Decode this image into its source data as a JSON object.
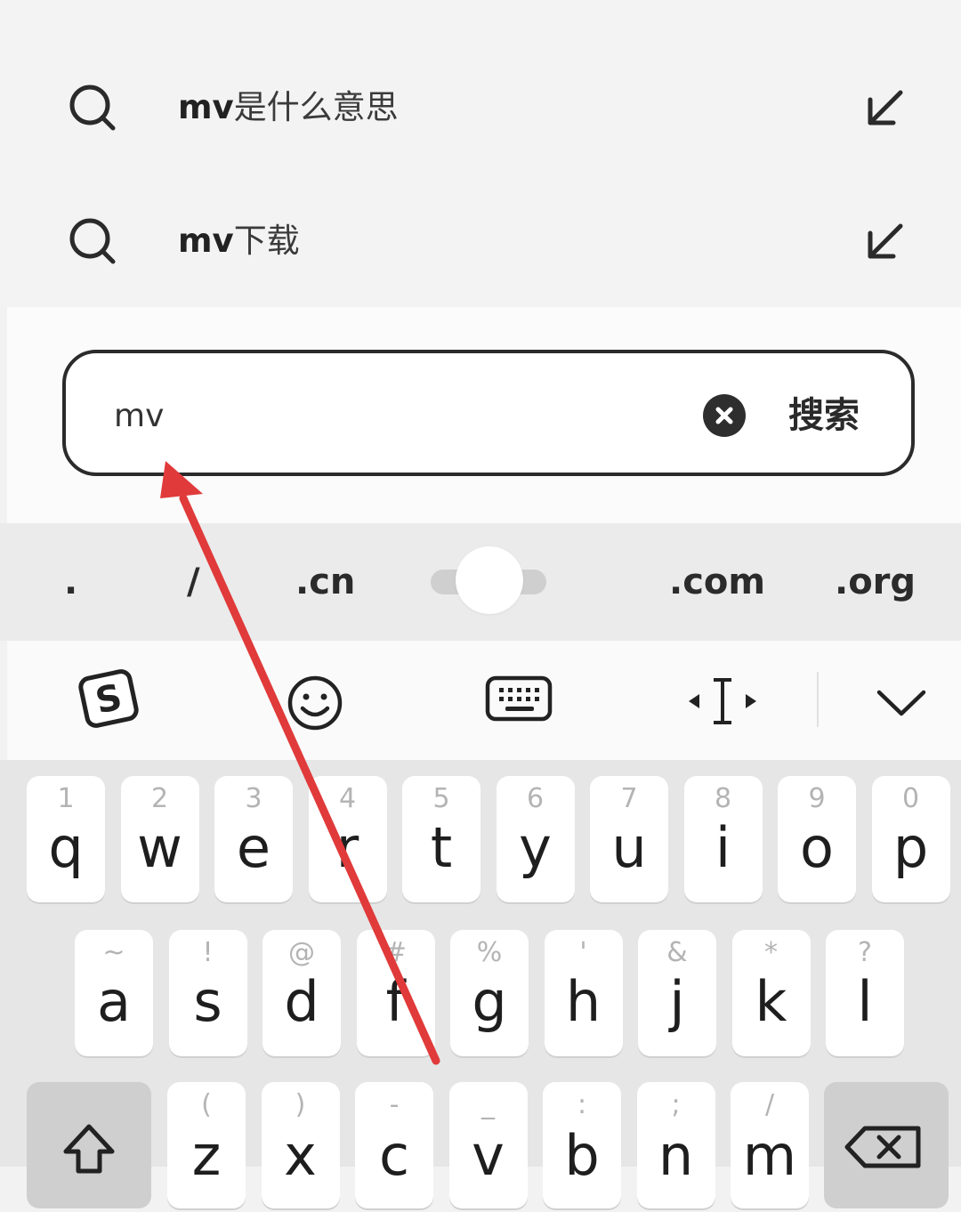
{
  "suggestions": [
    {
      "bold": "mv",
      "rest": "是什么意思"
    },
    {
      "bold": "mv",
      "rest": "下载"
    }
  ],
  "search": {
    "value": "mv",
    "button_label": "搜索"
  },
  "quick_row": [
    ".",
    "/",
    ".cn",
    ".com",
    ".org"
  ],
  "toolbar": {
    "items": [
      "sogou-logo-icon",
      "emoji-icon",
      "keyboard-icon",
      "cursor-move-icon",
      "collapse-icon"
    ]
  },
  "keyboard": {
    "row1": [
      {
        "hint": "1",
        "ch": "q"
      },
      {
        "hint": "2",
        "ch": "w"
      },
      {
        "hint": "3",
        "ch": "e"
      },
      {
        "hint": "4",
        "ch": "r"
      },
      {
        "hint": "5",
        "ch": "t"
      },
      {
        "hint": "6",
        "ch": "y"
      },
      {
        "hint": "7",
        "ch": "u"
      },
      {
        "hint": "8",
        "ch": "i"
      },
      {
        "hint": "9",
        "ch": "o"
      },
      {
        "hint": "0",
        "ch": "p"
      }
    ],
    "row2": [
      {
        "hint": "~",
        "ch": "a"
      },
      {
        "hint": "!",
        "ch": "s"
      },
      {
        "hint": "@",
        "ch": "d"
      },
      {
        "hint": "#",
        "ch": "f"
      },
      {
        "hint": "%",
        "ch": "g"
      },
      {
        "hint": "'",
        "ch": "h"
      },
      {
        "hint": "&",
        "ch": "j"
      },
      {
        "hint": "*",
        "ch": "k"
      },
      {
        "hint": "?",
        "ch": "l"
      }
    ],
    "row3": [
      {
        "hint": "(",
        "ch": "z"
      },
      {
        "hint": ")",
        "ch": "x"
      },
      {
        "hint": "-",
        "ch": "c"
      },
      {
        "hint": "_",
        "ch": "v"
      },
      {
        "hint": ":",
        "ch": "b"
      },
      {
        "hint": ";",
        "ch": "n"
      },
      {
        "hint": "/",
        "ch": "m"
      }
    ]
  },
  "colors": {
    "annotation_arrow": "#e03a3a",
    "search_border": "#2b2b2b"
  }
}
